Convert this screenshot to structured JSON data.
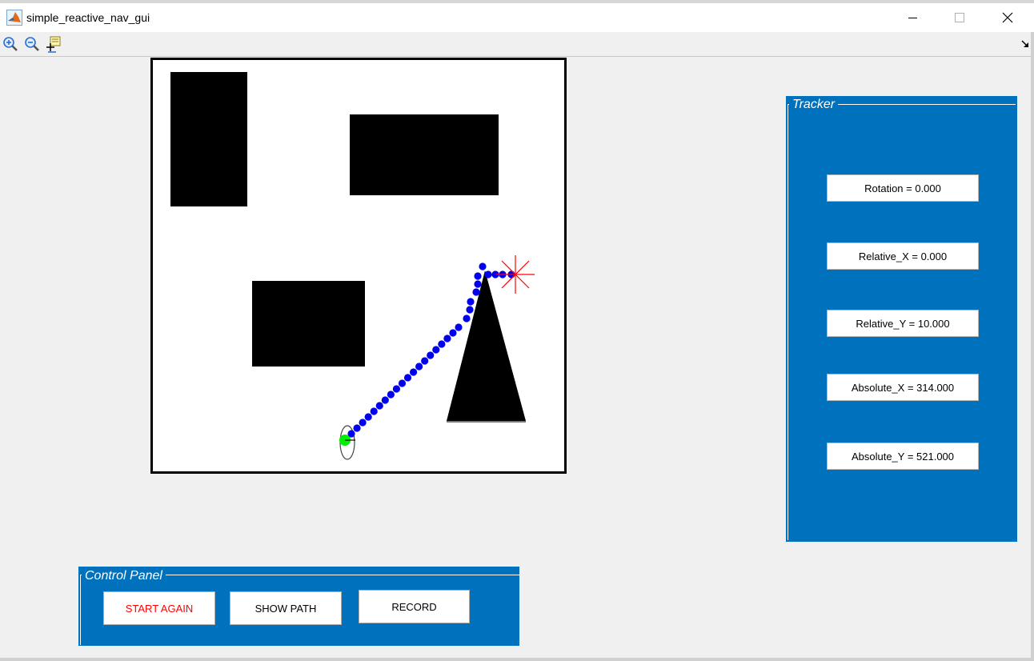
{
  "window": {
    "title": "simple_reactive_nav_gui",
    "controls": [
      "minimize-icon",
      "maximize-icon",
      "close-icon"
    ]
  },
  "toolbar": {
    "tools": [
      "zoom-in-icon",
      "zoom-out-icon",
      "data-cursor-icon"
    ]
  },
  "map": {
    "start_marker_color": "#00ee00",
    "path_color": "#0000ee",
    "goal_marker_color": "#ff0000",
    "obstacle_color": "#000000"
  },
  "tracker": {
    "title": "Tracker",
    "rotation": "Rotation = 0.000",
    "relative_x": "Relative_X = 0.000",
    "relative_y": "Relative_Y = 10.000",
    "absolute_x": "Absolute_X = 314.000",
    "absolute_y": "Absolute_Y = 521.000"
  },
  "control_panel": {
    "title": "Control Panel",
    "start_again": "START AGAIN",
    "show_path": "SHOW PATH",
    "record": "RECORD"
  },
  "colors": {
    "panel": "#0072bd",
    "start_again_text": "#ff0000"
  }
}
